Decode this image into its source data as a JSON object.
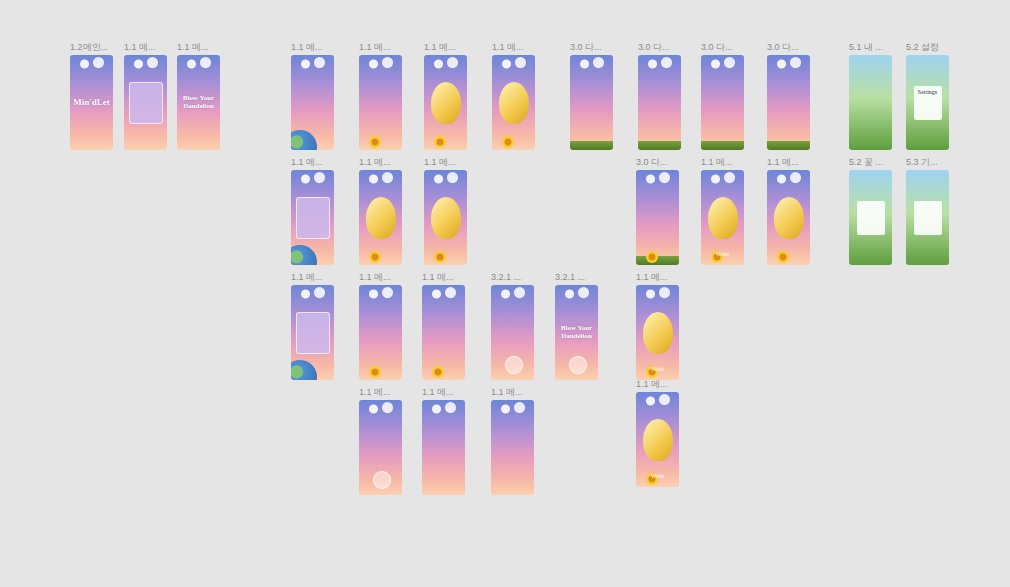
{
  "canvas": {
    "frames": [
      {
        "label": "1.2메인...",
        "kind": "title",
        "title": "Min'dLet"
      },
      {
        "label": "1.1 메...",
        "kind": "login"
      },
      {
        "label": "1.1 메...",
        "kind": "title",
        "title": "Blow Your Dandelion"
      },
      {
        "label": "1.1 메...",
        "kind": "earth"
      },
      {
        "label": "1.1 메...",
        "kind": "flower"
      },
      {
        "label": "1.1 메...",
        "kind": "letter"
      },
      {
        "label": "1.1 메...",
        "kind": "letter"
      },
      {
        "label": "3.0 다...",
        "kind": "ground"
      },
      {
        "label": "3.0 다...",
        "kind": "ground"
      },
      {
        "label": "3.0 다...",
        "kind": "ground"
      },
      {
        "label": "3.0 다...",
        "kind": "ground"
      },
      {
        "label": "5.1 내 ...",
        "kind": "garden"
      },
      {
        "label": "5.2 설정",
        "kind": "settings",
        "title": "Settings"
      },
      {
        "label": "1.1 메...",
        "kind": "login-earth"
      },
      {
        "label": "1.1 메...",
        "kind": "letter"
      },
      {
        "label": "1.1 메...",
        "kind": "letter"
      },
      {
        "label": "3.0 다...",
        "kind": "ground-flower"
      },
      {
        "label": "1.1 메...",
        "kind": "letter",
        "button": "Write"
      },
      {
        "label": "1.1 메...",
        "kind": "letter"
      },
      {
        "label": "5.2 꽃 ...",
        "kind": "settings"
      },
      {
        "label": "5.3 기...",
        "kind": "settings"
      },
      {
        "label": "1.1 메...",
        "kind": "login-earth"
      },
      {
        "label": "1.1 메...",
        "kind": "flower"
      },
      {
        "label": "1.1 메...",
        "kind": "flower"
      },
      {
        "label": "3.2.1 ...",
        "kind": "dandelion"
      },
      {
        "label": "3.2.1 ...",
        "kind": "title-dandelion",
        "title": "Blow Your Dandelion"
      },
      {
        "label": "1.1 메...",
        "kind": "letter",
        "button": "Write"
      },
      {
        "label": "1.1 메...",
        "kind": "dandelion"
      },
      {
        "label": "1.1 메...",
        "kind": "sky"
      },
      {
        "label": "1.1 메...",
        "kind": "sky"
      },
      {
        "label": "1.1 메...",
        "kind": "letter",
        "button": "Write"
      }
    ]
  }
}
